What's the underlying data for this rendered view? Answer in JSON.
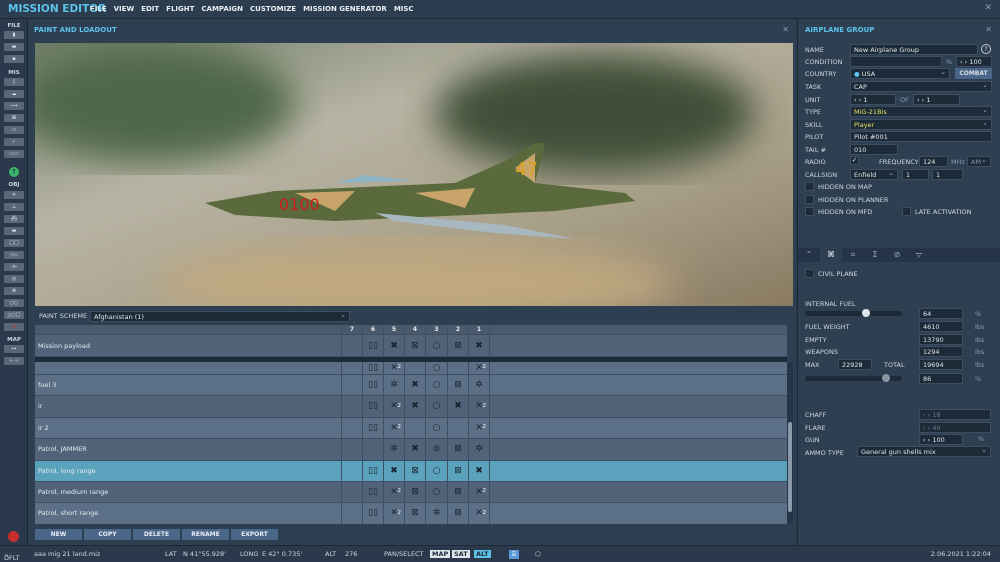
{
  "app": {
    "title": "MISSION EDITOR",
    "menu": [
      "FILE",
      "VIEW",
      "EDIT",
      "FLIGHT",
      "CAMPAIGN",
      "CUSTOMIZE",
      "MISSION GENERATOR",
      "MISC"
    ],
    "close": "✕"
  },
  "toolbar": {
    "sections": {
      "file": "FILE",
      "mis": "MIS",
      "obj": "OBJ",
      "map": "MAP"
    }
  },
  "loadout": {
    "title": "PAINT AND LOADOUT",
    "close": "✕",
    "aircraft_markings": {
      "number": "0100",
      "tail": "47"
    },
    "paint_scheme_label": "PAINT SCHEME",
    "paint_scheme": "Afghanistan (1)",
    "stations": [
      "7",
      "6",
      "5",
      "4",
      "3",
      "2",
      "1"
    ],
    "mission_payload": {
      "name": "Mission payload",
      "cells": [
        "",
        "tanks",
        "X",
        "x",
        "o",
        "x",
        "X"
      ]
    },
    "rows": [
      {
        "name": "fuel 3",
        "cells": [
          "",
          "tanks",
          "s",
          "X",
          "o",
          "x",
          "s"
        ]
      },
      {
        "name": "ir",
        "cells": [
          "",
          "tanks",
          "X2",
          "X",
          "o",
          "X",
          "X2"
        ]
      },
      {
        "name": "ir 2",
        "cells": [
          "",
          "tanks",
          "X2",
          "",
          "o",
          "",
          "X2"
        ]
      },
      {
        "name": "Patrol, JAMMER",
        "cells": [
          "",
          "",
          "s",
          "X",
          "j",
          "x",
          "s"
        ]
      },
      {
        "name": "Patrol, long range",
        "cells": [
          "",
          "tanks",
          "X",
          "x",
          "o",
          "x",
          "X"
        ],
        "selected": true
      },
      {
        "name": "Patrol, medium range",
        "cells": [
          "",
          "tanks",
          "X2",
          "x",
          "o",
          "x",
          "X2"
        ]
      },
      {
        "name": "Patrol, short range",
        "cells": [
          "",
          "tanks",
          "X2",
          "x",
          "s",
          "x",
          "X2"
        ]
      }
    ],
    "buttons": [
      "NEW",
      "COPY",
      "DELETE",
      "RENAME",
      "EXPORT"
    ]
  },
  "group": {
    "title": "AIRPLANE GROUP",
    "close": "✕",
    "help": "?",
    "name_label": "NAME",
    "name": "New Airplane Group",
    "condition_label": "CONDITION",
    "condition": "",
    "condition_unit": "%",
    "condition_value": "100",
    "country_label": "COUNTRY",
    "country": "USA",
    "combat": "COMBAT",
    "task_label": "TASK",
    "task": "CAP",
    "unit_label": "UNIT",
    "unit": "1",
    "of_label": "OF",
    "unit_of": "1",
    "type_label": "TYPE",
    "type": "MiG-21Bis",
    "skill_label": "SKILL",
    "skill": "Player",
    "pilot_label": "PILOT",
    "pilot": "Pilot #001",
    "tail_label": "TAIL #",
    "tail": "010",
    "radio_label": "RADIO",
    "radio_checked": true,
    "frequency_label": "FREQUENCY",
    "frequency": "124",
    "freq_unit": "MHz",
    "modulation": "AM",
    "callsign_label": "CALLSIGN",
    "callsign": "Enfield",
    "callsign_n1": "1",
    "callsign_n2": "1",
    "hidden_map": "HIDDEN ON MAP",
    "hidden_planner": "HIDDEN ON PLANNER",
    "hidden_mfd": "HIDDEN ON MFD",
    "late_activation": "LATE ACTIVATION",
    "tabs": [
      "route-icon",
      "payload-icon",
      "aircraft-icon",
      "summary-icon",
      "forbidden-icon",
      "radio-icon"
    ],
    "civil_plane": "CIVIL PLANE",
    "internal_fuel_label": "INTERNAL FUEL",
    "internal_fuel": "64",
    "internal_fuel_unit": "%",
    "internal_fuel_fraction": 0.64,
    "fuel_weight_label": "FUEL WEIGHT",
    "fuel_weight": "4610",
    "empty_label": "EMPTY",
    "empty": "13790",
    "weapons_label": "WEAPONS",
    "weapons": "1294",
    "max_label": "MAX",
    "max": "22928",
    "total_label": "TOTAL",
    "total": "19694",
    "lbs": "lbs",
    "total_pct": "86",
    "total_fraction": 0.86,
    "chaff_label": "CHAFF",
    "chaff": "18",
    "flare_label": "FLARE",
    "flare": "40",
    "gun_label": "GUN",
    "gun": "100",
    "gun_unit": "%",
    "ammo_label": "AMMO TYPE",
    "ammo": "General gun shells mix"
  },
  "status": {
    "mode": "DFLT",
    "file": "aaa mig 21 land.miz",
    "lat_label": "LAT",
    "lat": "N 41°55.928'",
    "long_label": "LONG",
    "long": "E 42° 0.735'",
    "alt_label": "ALT",
    "alt": "276",
    "pan": "PAN/SELECT",
    "map": "MAP",
    "sat": "SAT",
    "alt_btn": "ALT",
    "datetime": "2.06.2021 1:22:04"
  },
  "colors": {
    "accent": "#5cc2ea",
    "selected_row": "#5ba3bc",
    "type_text": "#e8e060"
  }
}
